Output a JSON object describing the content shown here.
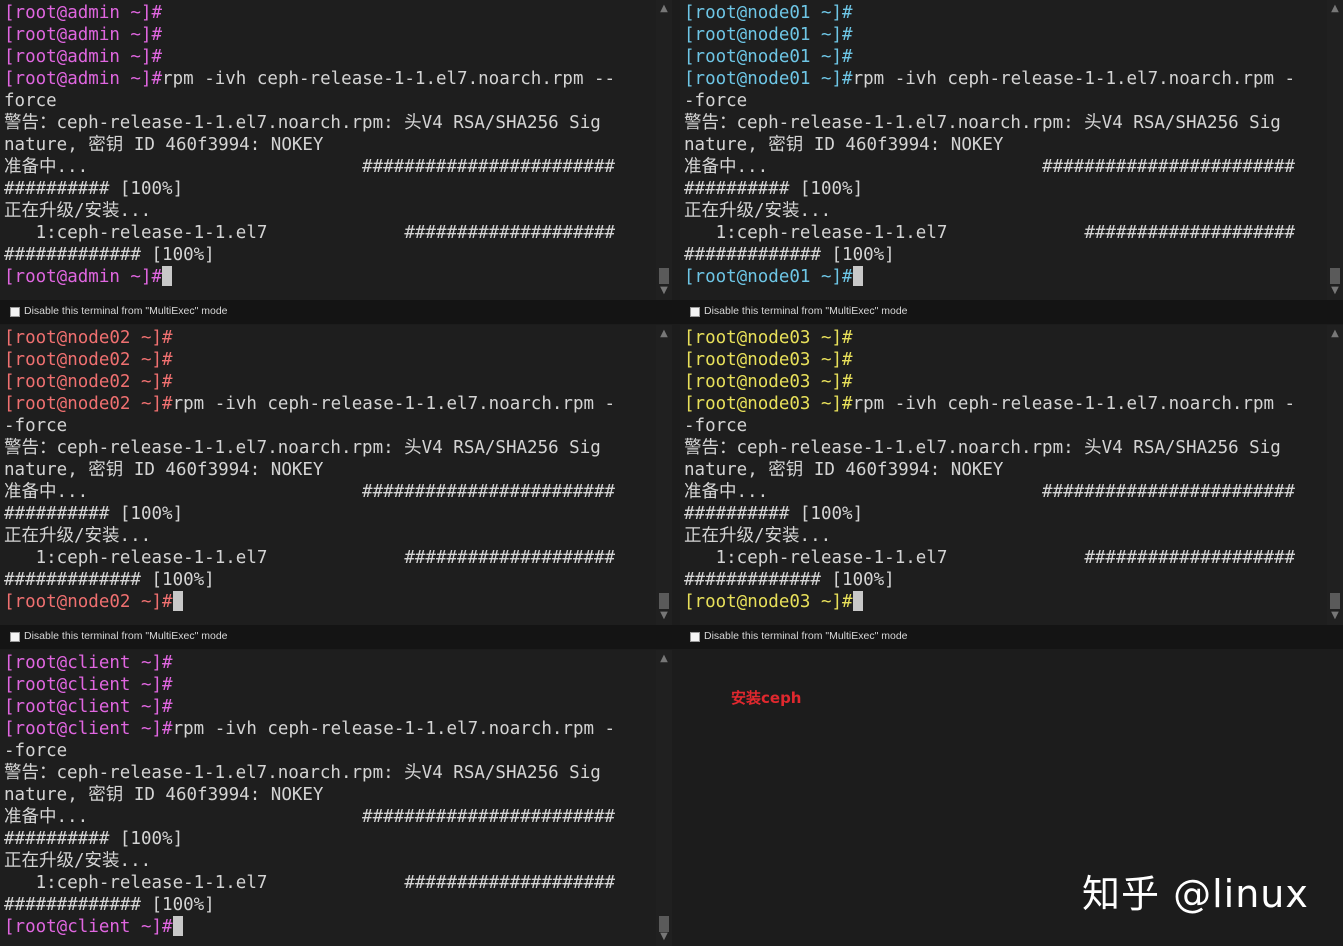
{
  "multiexec_label": "Disable this terminal from \"MultiExec\" mode",
  "colors": {
    "admin": "#e066e0",
    "node01": "#6ec6e6",
    "node02": "#f07070",
    "node03": "#e8e05a",
    "client": "#e066e0",
    "output": "#d4d4d4"
  },
  "terminals": {
    "admin": {
      "prompt": "[root@admin ~]#",
      "line1": "rpm -ivh ceph-release-1-1.el7.noarch.rpm --",
      "line2": "force"
    },
    "node01": {
      "prompt": "[root@node01 ~]#",
      "line1": "rpm -ivh ceph-release-1-1.el7.noarch.rpm -",
      "line2": "-force"
    },
    "node02": {
      "prompt": "[root@node02 ~]#",
      "line1": "rpm -ivh ceph-release-1-1.el7.noarch.rpm -",
      "line2": "-force"
    },
    "node03": {
      "prompt": "[root@node03 ~]#",
      "line1": "rpm -ivh ceph-release-1-1.el7.noarch.rpm -",
      "line2": "-force"
    },
    "client": {
      "prompt": "[root@client ~]#",
      "line1": "rpm -ivh ceph-release-1-1.el7.noarch.rpm -",
      "line2": "-force"
    }
  },
  "output": {
    "warn1": "警告：ceph-release-1-1.el7.noarch.rpm: 头V4 RSA/SHA256 Sig",
    "warn2": "nature, 密钥 ID 460f3994: NOKEY",
    "prep1": "准备中...                          ########################",
    "prep2": "########## [100%]",
    "upgrade": "正在升级/安装...",
    "pkg1": "   1:ceph-release-1-1.el7             ####################",
    "pkg2": "############# [100%]"
  },
  "annotation": "安装ceph",
  "watermark": "知乎 @linux"
}
